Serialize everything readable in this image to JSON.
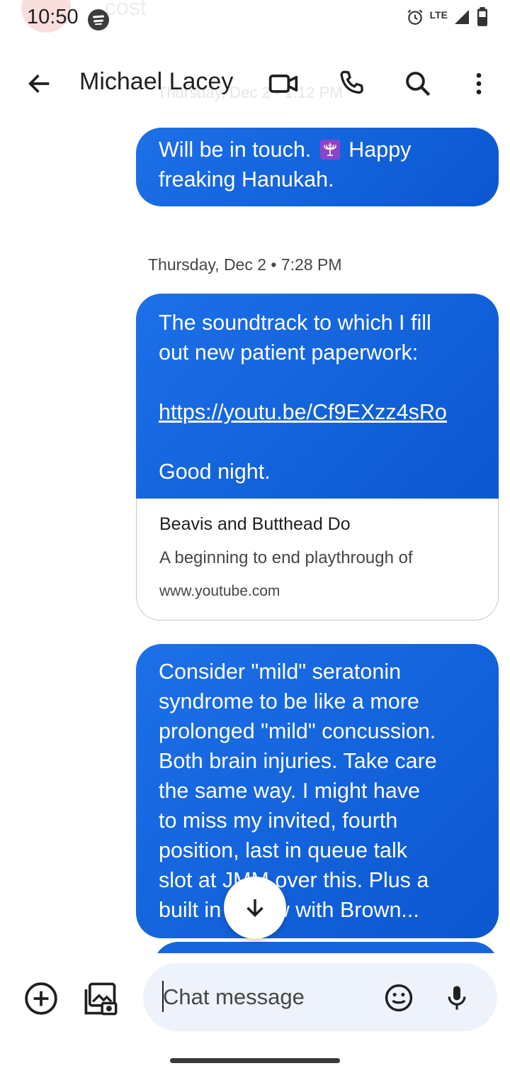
{
  "status_bar": {
    "time": "10:50",
    "network": "LTE",
    "icons": [
      "spotify-icon",
      "alarm-icon",
      "lte-signal-icon",
      "battery-icon"
    ]
  },
  "background_peek": {
    "text": "cost",
    "timestamp": "Thursday, Dec 2 • 1:12 PM"
  },
  "app_bar": {
    "contact_name": "Michael Lacey",
    "icons": [
      "back-arrow-icon",
      "video-call-icon",
      "phone-icon",
      "search-icon",
      "more-vert-icon"
    ]
  },
  "messages": {
    "first": {
      "lines": [
        "Will be in touch.",
        "Happy",
        "freaking Hanukah."
      ],
      "emoji": "menorah-emoji"
    },
    "date_separator": "Thursday, Dec 2 • 7:28 PM",
    "second": {
      "line1": "The soundtrack to which I fill",
      "line2": "out new patient paperwork:",
      "link": "https://youtu.be/Cf9EXzz4sRo",
      "line3": "Good night.",
      "preview": {
        "title": "Beavis and Butthead Do",
        "description": "A beginning to end playthrough of",
        "domain": "www.youtube.com"
      }
    },
    "third": {
      "lines": [
        "Consider \"mild\" seratonin",
        "syndrome to be like a more",
        "prolonged \"mild\" concussion.",
        "Both brain injuries. Take care",
        "the same way. I might have",
        "to miss my invited, fourth",
        "position, last in queue talk",
        "slot at JMM over this. Plus a",
        "built in review with Brown..."
      ]
    }
  },
  "scroll_down_icon": "arrow-down-icon",
  "compose": {
    "placeholder": "Chat message",
    "icons": [
      "add-circle-icon",
      "gallery-icon",
      "emoji-icon",
      "mic-icon"
    ]
  },
  "colors": {
    "bubble": "#0b57d0",
    "compose_background": "#eef2fa",
    "text_primary": "#1f1f1f"
  }
}
